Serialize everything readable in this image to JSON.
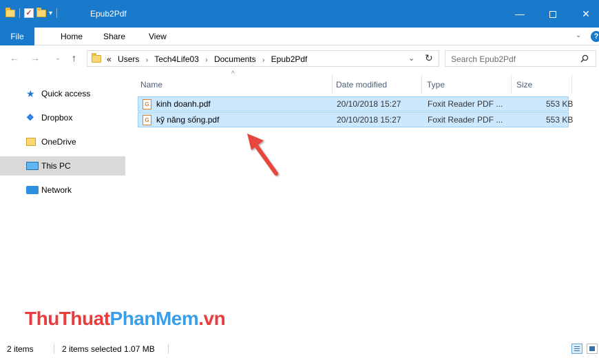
{
  "window": {
    "title": "Epub2Pdf",
    "minimize_glyph": "—",
    "close_glyph": "✕",
    "dropdown_glyph": "▾",
    "qa_check_glyph": "✓"
  },
  "ribbon": {
    "tabs": [
      {
        "label": "File"
      },
      {
        "label": "Home"
      },
      {
        "label": "Share"
      },
      {
        "label": "View"
      }
    ],
    "collapse_glyph": "⌄",
    "help_glyph": "?"
  },
  "navigation": {
    "back_glyph": "←",
    "forward_glyph": "→",
    "recent_glyph": "⌄",
    "up_glyph": "↑"
  },
  "address": {
    "overflow": "«",
    "crumbs": [
      "Users",
      "Tech4Life03",
      "Documents",
      "Epub2Pdf"
    ],
    "separator": "›",
    "dropdown_glyph": "⌄",
    "refresh_glyph": "↻"
  },
  "search": {
    "placeholder": "Search Epub2Pdf"
  },
  "nav_pane": {
    "items": [
      {
        "label": "Quick access",
        "icon": "star-icon"
      },
      {
        "label": "Dropbox",
        "icon": "dropbox-icon"
      },
      {
        "label": "OneDrive",
        "icon": "onedrive-icon"
      },
      {
        "label": "This PC",
        "icon": "computer-icon",
        "selected": true
      },
      {
        "label": "Network",
        "icon": "network-icon"
      }
    ]
  },
  "file_list": {
    "sort_glyph": "^",
    "columns": [
      "Name",
      "Date modified",
      "Type",
      "Size"
    ],
    "rows": [
      {
        "name": "kinh doanh.pdf",
        "date": "20/10/2018 15:27",
        "type": "Foxit Reader PDF ...",
        "size": "553 KB",
        "selected": true
      },
      {
        "name": "kỹ năng sống.pdf",
        "date": "20/10/2018 15:27",
        "type": "Foxit Reader PDF ...",
        "size": "553 KB",
        "selected": true
      }
    ],
    "file_icon_label": "G"
  },
  "watermark": {
    "part1": "ThuThuat",
    "part2": "PhanMem",
    "part3": ".vn"
  },
  "status": {
    "count": "2 items",
    "selection": "2 items selected  1.07 MB"
  },
  "colors": {
    "titlebar": "#1979ca",
    "selection": "#cce8ff",
    "selection_border": "#99d1ff",
    "arrow": "#e8453c"
  }
}
